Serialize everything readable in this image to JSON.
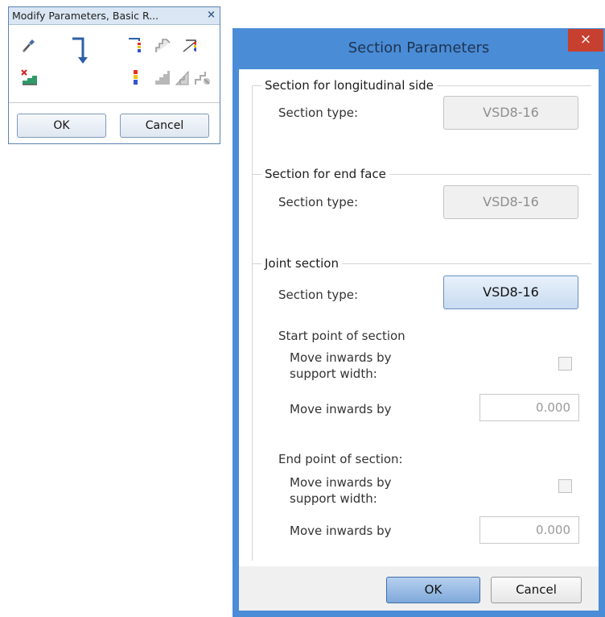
{
  "palette": {
    "title": "Modify Parameters, Basic R...",
    "close_glyph": "×",
    "tools": [
      {
        "name": "eyedropper-icon"
      },
      {
        "name": "arrow-down-bend-icon"
      },
      {
        "name": "color-pipe-icon"
      },
      {
        "name": "stair-profile-icon"
      },
      {
        "name": "stair-edge-icon"
      },
      {
        "name": "delete-stair-icon"
      },
      {
        "name": "color-bar-icon"
      },
      {
        "name": "stair-gray-icon"
      },
      {
        "name": "stair-side-gray-icon"
      },
      {
        "name": "stair-link-gray-icon"
      }
    ],
    "ok_label": "OK",
    "cancel_label": "Cancel"
  },
  "dialog": {
    "title": "Section Parameters",
    "close_glyph": "×",
    "longitudinal": {
      "group_title": "Section for longitudinal side",
      "type_label": "Section type:",
      "type_value": "VSD8-16"
    },
    "end_face": {
      "group_title": "Section for end face",
      "type_label": "Section type:",
      "type_value": "VSD8-16"
    },
    "joint": {
      "group_title": "Joint section",
      "type_label": "Section type:",
      "type_value": "VSD8-16",
      "start": {
        "heading": "Start point of section",
        "move_support_line1": "Move inwards by",
        "move_support_line2": "support width:",
        "move_by_label": "Move inwards by",
        "move_by_value": "0.000",
        "support_checked": false
      },
      "end": {
        "heading": "End point of section:",
        "move_support_line1": "Move inwards by",
        "move_support_line2": "support width:",
        "move_by_label": "Move inwards by",
        "move_by_value": "0.000",
        "support_checked": false
      }
    },
    "ok_label": "OK",
    "cancel_label": "Cancel"
  },
  "colors": {
    "dialog_frame": "#4a8cd6",
    "close_button": "#c7402f",
    "palette_title_bar": "#dae6f3"
  }
}
